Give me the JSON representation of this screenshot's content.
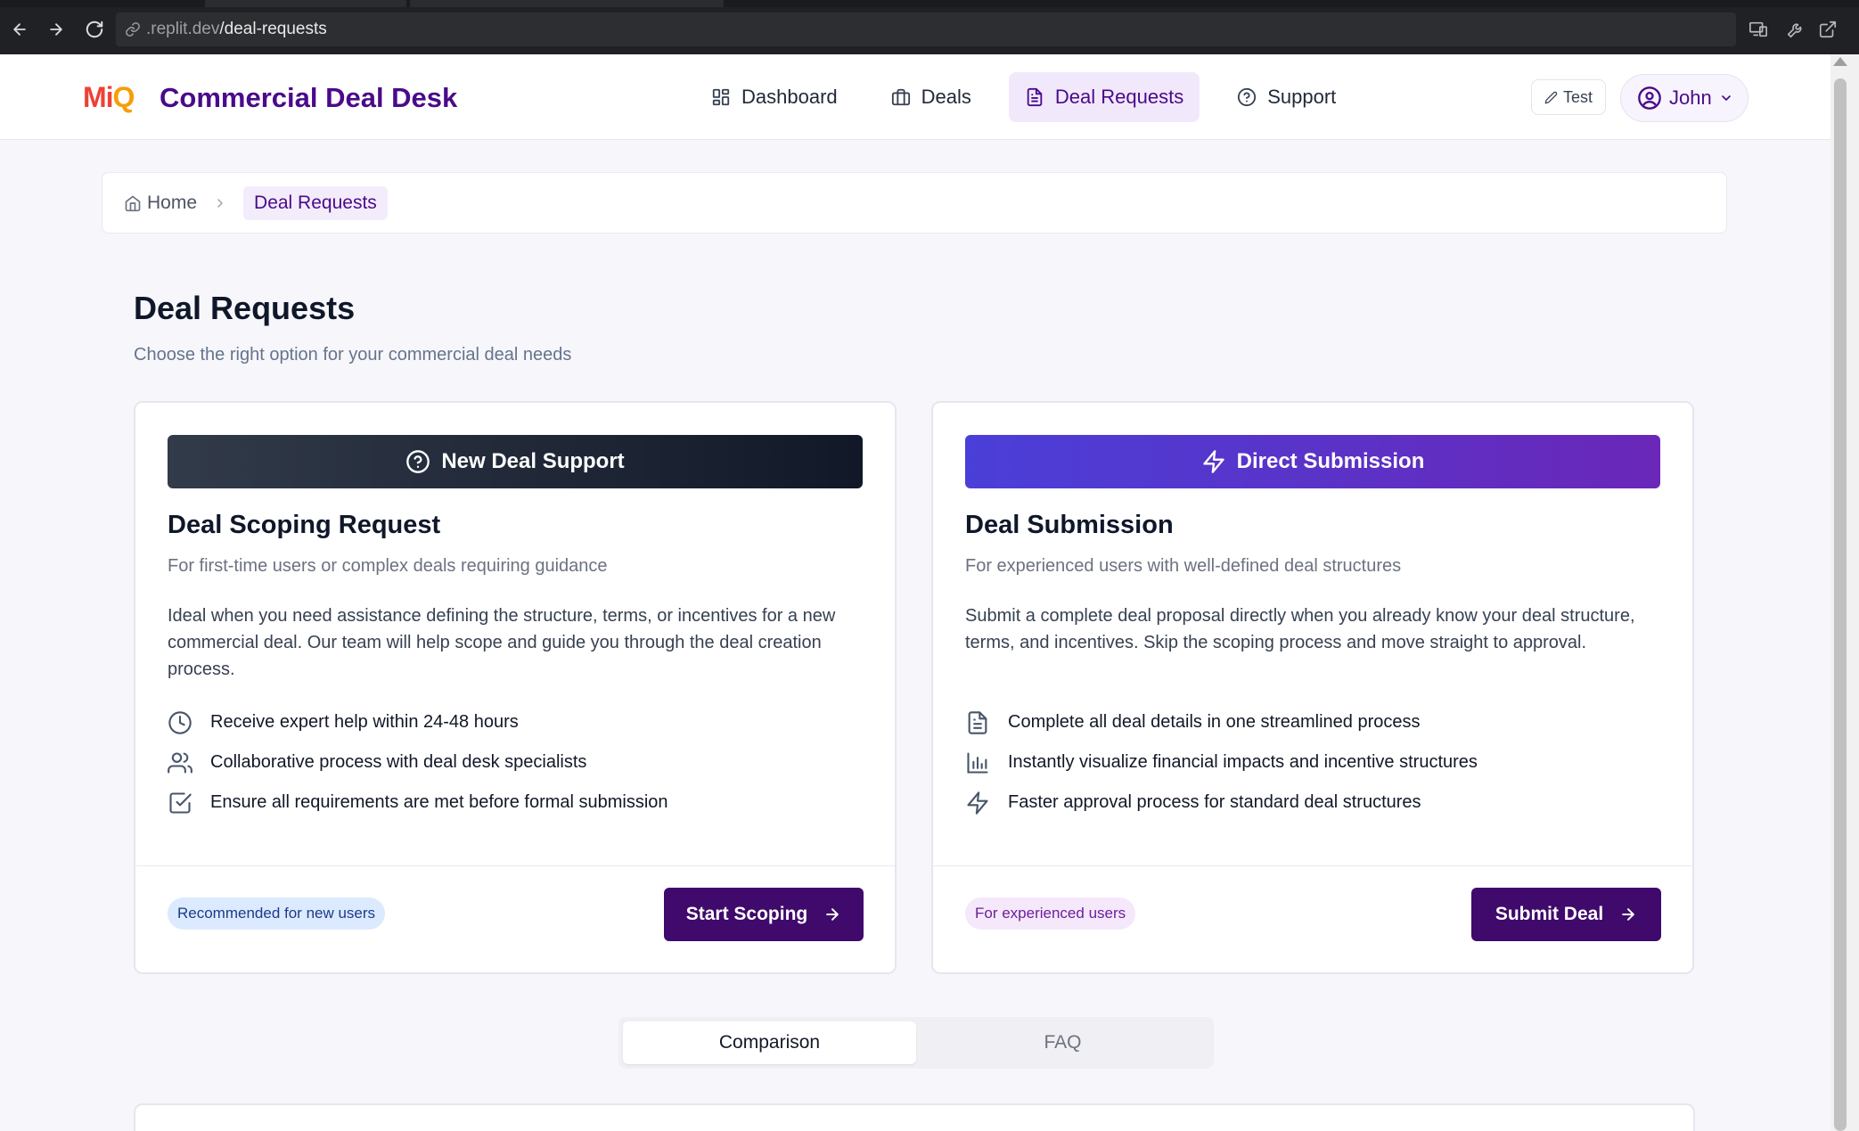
{
  "browser": {
    "url_dim": ".replit.dev",
    "url_path": "/deal-requests"
  },
  "header": {
    "logo_part1": "Mi",
    "logo_part2": "Q",
    "app_title": "Commercial Deal Desk",
    "nav": [
      {
        "label": "Dashboard",
        "icon": "dashboard-icon"
      },
      {
        "label": "Deals",
        "icon": "briefcase-icon"
      },
      {
        "label": "Deal Requests",
        "icon": "file-text-icon"
      },
      {
        "label": "Support",
        "icon": "help-circle-icon"
      }
    ],
    "active_nav": "Deal Requests",
    "test_label": "Test",
    "user_name": "John"
  },
  "breadcrumb": {
    "home": "Home",
    "current": "Deal Requests"
  },
  "page": {
    "title": "Deal Requests",
    "subtitle": "Choose the right option for your commercial deal needs"
  },
  "cards": [
    {
      "banner": "New Deal Support",
      "banner_icon": "help-circle-icon",
      "heading": "Deal Scoping Request",
      "lead": "For first-time users or complex deals requiring guidance",
      "description": "Ideal when you need assistance defining the structure, terms, or incentives for a new commercial deal. Our team will help scope and guide you through the deal creation process.",
      "features": [
        {
          "text": "Receive expert help within 24-48 hours",
          "icon": "clock-icon"
        },
        {
          "text": "Collaborative process with deal desk specialists",
          "icon": "users-icon"
        },
        {
          "text": "Ensure all requirements are met before formal submission",
          "icon": "check-square-icon"
        }
      ],
      "badge": "Recommended for new users",
      "cta": "Start Scoping"
    },
    {
      "banner": "Direct Submission",
      "banner_icon": "lightning-icon",
      "heading": "Deal Submission",
      "lead": "For experienced users with well-defined deal structures",
      "description": "Submit a complete deal proposal directly when you already know your deal structure, terms, and incentives. Skip the scoping process and move straight to approval.",
      "features": [
        {
          "text": "Complete all deal details in one streamlined process",
          "icon": "file-text-icon"
        },
        {
          "text": "Instantly visualize financial impacts and incentive structures",
          "icon": "bar-chart-icon"
        },
        {
          "text": "Faster approval process for standard deal structures",
          "icon": "lightning-icon"
        }
      ],
      "badge": "For experienced users",
      "cta": "Submit Deal"
    }
  ],
  "tabs": [
    {
      "label": "Comparison",
      "active": true
    },
    {
      "label": "FAQ",
      "active": false
    }
  ],
  "colors": {
    "brand_purple": "#4a0a8a",
    "cta_purple": "#3f0a6b",
    "banner_dark": "#111827",
    "banner_purple_start": "#4a3fd8",
    "banner_purple_end": "#6a27b8",
    "badge_blue_bg": "#dbeafe",
    "badge_purple_bg": "#f5e8fb"
  }
}
